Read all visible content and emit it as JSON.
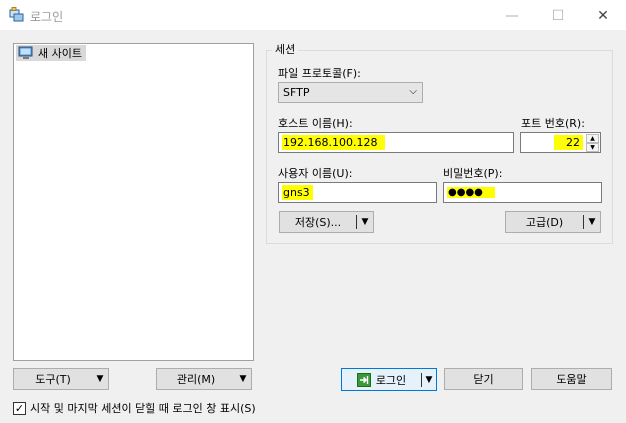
{
  "window": {
    "title": "로그인",
    "minimize_glyph": "—",
    "maximize_glyph": "☐",
    "close_glyph": "✕"
  },
  "site_tree": {
    "items": [
      {
        "label": "새 사이트",
        "icon": "computer-icon"
      }
    ]
  },
  "session": {
    "legend": "세션",
    "protocol_label": "파일 프로토콜(F):",
    "protocol_value": "SFTP",
    "host_label": "호스트 이름(H):",
    "host_value": "192.168.100.128",
    "port_label": "포트 번호(R):",
    "port_value": "22",
    "user_label": "사용자 이름(U):",
    "user_value": "gns3",
    "password_label": "비밀번호(P):",
    "password_value": "●●●●",
    "save_label": "저장(S)...",
    "advanced_label": "고급(D)"
  },
  "bottom": {
    "tools_label": "도구(T)",
    "manage_label": "관리(M)",
    "login_label": "로그인",
    "close_label": "닫기",
    "help_label": "도움말",
    "show_on_start_label": "시작 및 마지막 세션이 닫힐 때 로그인 창 표시(S)",
    "show_on_start_checked": true
  },
  "colors": {
    "highlight": "#ffff00",
    "accent": "#0078d7"
  }
}
